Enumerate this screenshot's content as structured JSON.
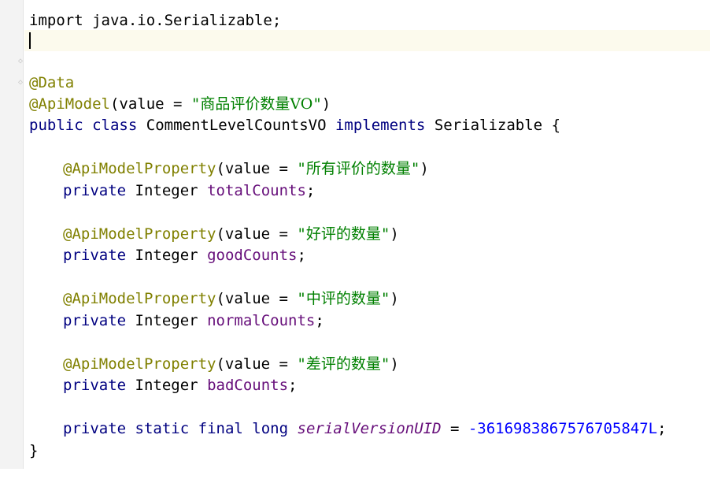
{
  "editor": {
    "header_line": "import java.io.Serializable;",
    "class_annotations": [
      {
        "name": "@Data",
        "value": null
      },
      {
        "name": "@ApiModel",
        "value": "商品评价数量VO"
      }
    ],
    "class_decl": {
      "modifier1": "public",
      "modifier2": "class",
      "name": "CommentLevelCountsVO",
      "implements_kw": "implements",
      "interface": "Serializable",
      "open_brace": "{"
    },
    "fields": [
      {
        "annotation": "@ApiModelProperty",
        "value": "所有评价的数量",
        "modifier": "private",
        "type": "Integer",
        "name": "totalCounts"
      },
      {
        "annotation": "@ApiModelProperty",
        "value": "好评的数量",
        "modifier": "private",
        "type": "Integer",
        "name": "goodCounts"
      },
      {
        "annotation": "@ApiModelProperty",
        "value": "中评的数量",
        "modifier": "private",
        "type": "Integer",
        "name": "normalCounts"
      },
      {
        "annotation": "@ApiModelProperty",
        "value": "差评的数量",
        "modifier": "private",
        "type": "Integer",
        "name": "badCounts"
      }
    ],
    "serial": {
      "modifier1": "private",
      "modifier2": "static",
      "modifier3": "final",
      "type": "long",
      "name": "serialVersionUID",
      "value": "-3616983867576705847L"
    },
    "close_brace": "}"
  },
  "colors": {
    "keyword": "#000080",
    "annotation": "#808000",
    "string": "#008000",
    "field": "#660e7a",
    "number": "#0000ff",
    "current_line": "#fcfaed",
    "gutter": "#f3f3f3"
  },
  "icons": [
    "fold-icon"
  ]
}
